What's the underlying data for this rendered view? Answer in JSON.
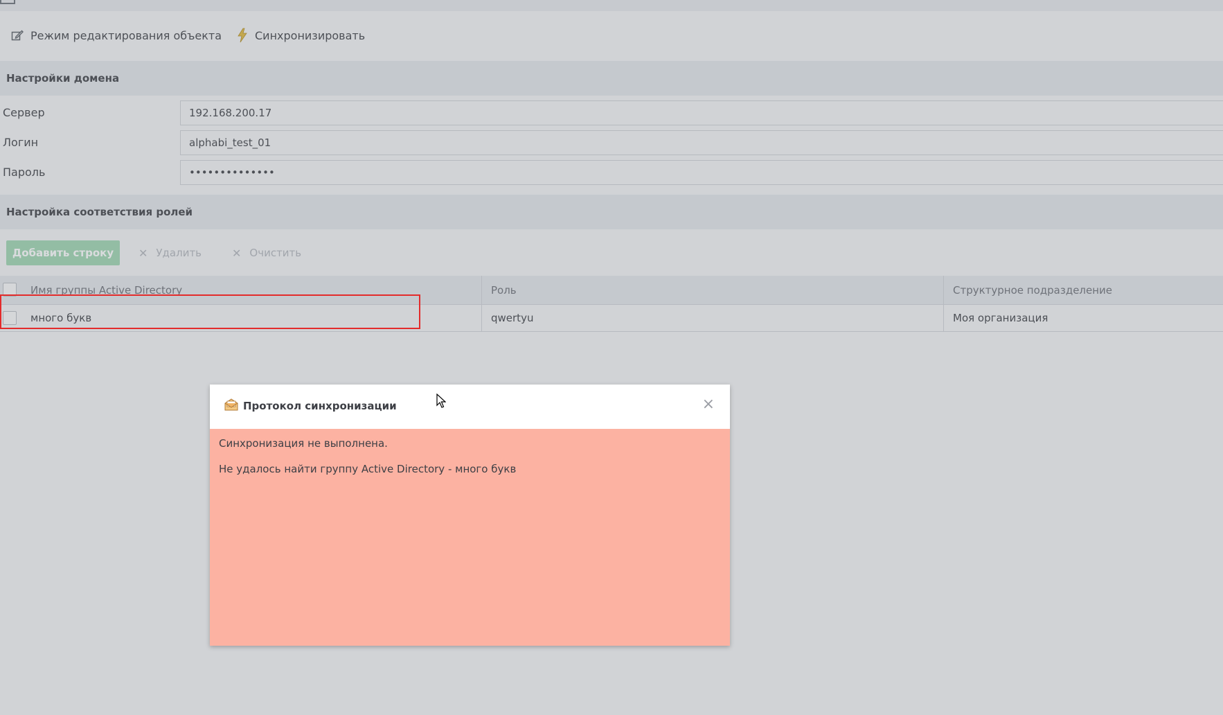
{
  "toolbar": {
    "edit_mode_label": "Режим редактирования объекта",
    "sync_label": "Синхронизировать"
  },
  "domain_settings": {
    "title": "Настройки домена",
    "fields": [
      {
        "label": "Сервер",
        "value": "192.168.200.17"
      },
      {
        "label": "Логин",
        "value": "alphabi_test_01"
      },
      {
        "label": "Пароль",
        "value": "••••••••••••••"
      }
    ]
  },
  "role_mapping": {
    "title": "Настройка соответствия ролей",
    "add_button": "Добавить строку",
    "delete_button": "Удалить",
    "clear_button": "Очистить",
    "columns": [
      "Имя группы Active Directory",
      "Роль",
      "Структурное подразделение"
    ],
    "rows": [
      {
        "group": "много букв",
        "role": "qwertyu",
        "department": "Моя организация"
      }
    ]
  },
  "dialog": {
    "title": "Протокол синхронизации",
    "messages": [
      "Синхронизация не выполнена.",
      "Не удалось найти группу Active Directory - много букв"
    ]
  },
  "colors": {
    "error_background": "#fcb2a2",
    "highlight_border": "#e32b2b",
    "add_button": "#9fd6b1"
  }
}
